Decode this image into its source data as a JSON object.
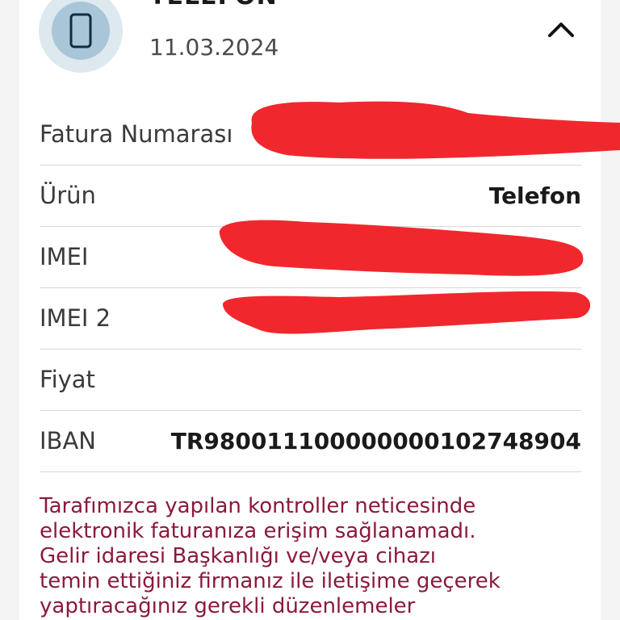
{
  "header": {
    "title": "TELEFON",
    "date": "11.03.2024",
    "icon": "phone-icon",
    "toggle_icon": "chevron-up-icon"
  },
  "rows": [
    {
      "label": "Fatura Numarası",
      "value": ""
    },
    {
      "label": "Ürün",
      "value": "Telefon"
    },
    {
      "label": "IMEI",
      "value": ""
    },
    {
      "label": "IMEI 2",
      "value": ""
    },
    {
      "label": "Fiyat",
      "value": ""
    },
    {
      "label": "IBAN",
      "value": "TR980011100000000102748904"
    }
  ],
  "notice": {
    "lines": [
      "Tarafımızca yapılan kontroller neticesinde",
      "elektronik faturanıza erişim sağlanamadı.",
      "Gelir idaresi Başkanlığı ve/veya cihazı",
      "temin ettiğiniz firmanız ile iletişime geçerek",
      "yaptıracağınız gerekli düzenlemeler"
    ]
  },
  "colors": {
    "notice_text": "#8a1a3a",
    "icon_bg_outer": "#dde8ef",
    "icon_bg_inner": "#a8c6d8",
    "redaction": "#f0282d"
  }
}
